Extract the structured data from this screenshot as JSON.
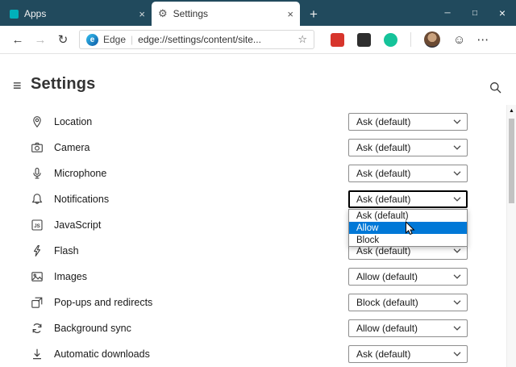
{
  "icons": {
    "gear": "⚙",
    "tab_close": "×",
    "new_tab": "+",
    "minimize": "─",
    "maximize": "□",
    "window_close": "×",
    "back": "←",
    "forward": "→",
    "refresh": "↻",
    "star": "☆",
    "smiley": "☺",
    "overflow_menu": "⋯",
    "hamburger": "≡",
    "scroll_up": "▲",
    "js_badge": "JS"
  },
  "tabbar": {
    "tabs": [
      {
        "label": "Apps",
        "active": false
      },
      {
        "label": "Settings",
        "active": true
      }
    ]
  },
  "navbar": {
    "edge_logo_letter": "e",
    "edge_label": "Edge",
    "url": "edge://settings/content/site..."
  },
  "page": {
    "title": "Settings"
  },
  "settings": [
    {
      "label": "Location",
      "value": "Ask (default)"
    },
    {
      "label": "Camera",
      "value": "Ask (default)"
    },
    {
      "label": "Microphone",
      "value": "Ask (default)"
    },
    {
      "label": "Notifications",
      "value": "Ask (default)",
      "focused": true
    },
    {
      "label": "JavaScript",
      "value": ""
    },
    {
      "label": "Flash",
      "value": "Ask (default)"
    },
    {
      "label": "Images",
      "value": "Allow (default)"
    },
    {
      "label": "Pop-ups and redirects",
      "value": "Block (default)"
    },
    {
      "label": "Background sync",
      "value": "Allow (default)"
    },
    {
      "label": "Automatic downloads",
      "value": "Ask (default)"
    }
  ],
  "popup": {
    "for_setting": "Notifications",
    "options": [
      {
        "label": "Ask (default)",
        "highlighted": false
      },
      {
        "label": "Allow",
        "highlighted": true
      },
      {
        "label": "Block",
        "highlighted": false
      }
    ]
  },
  "colors": {
    "tabbar_bg": "#214a5d",
    "accent": "#0078d7",
    "highlight_bg": "#0078d7",
    "apps_tab_icon": "#00b0ba",
    "extension_red": "#d7352c",
    "extension_dark": "#2e2e2e",
    "extension_green": "#15c39a"
  }
}
